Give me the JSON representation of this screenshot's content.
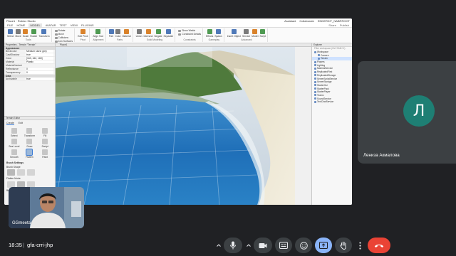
{
  "screen_share": {
    "title_left": "Place1 · Roblox Studio",
    "title_right": [
      "Assistant",
      "Collaborate"
    ],
    "user": "ENDERKIT_NABRROOT",
    "menu": [
      "FILE",
      "HOME",
      "MODEL",
      "AVATAR",
      "TEST",
      "VIEW",
      "PLUGINS"
    ],
    "menu_active": "MODEL",
    "menu_right": [
      "Share",
      "Publish"
    ],
    "ribbon_groups": [
      {
        "label": "Tools",
        "tools": [
          "Select",
          "Move",
          "Scale",
          "Rotate",
          "Transform"
        ]
      },
      {
        "label": "Snapping",
        "mini": [
          "Rotate",
          "Move",
          "Collisions",
          "Join Surfaces"
        ]
      },
      {
        "label": "Pivot",
        "tools": [
          "Edit Pivot"
        ]
      },
      {
        "label": "Alignment",
        "tools": [
          "Align Tool"
        ]
      },
      {
        "label": "Parts",
        "tools": [
          "Part",
          "Color",
          "Material"
        ]
      },
      {
        "label": "Solid Modeling",
        "tools": [
          "Union",
          "Intersect",
          "Negate",
          "Separate"
        ]
      },
      {
        "label": "Constraints",
        "mini": [
          "Show Welds",
          "Constraint Details"
        ]
      },
      {
        "label": "Gameplay",
        "tools": [
          "Effects",
          "Spawn"
        ]
      },
      {
        "label": "Advanced",
        "tools": [
          "Insert Object",
          "Service",
          "Model",
          "Script"
        ]
      }
    ],
    "properties_header": "Properties - Terrain \"Terrain\"",
    "properties": [
      {
        "section": "Appearance"
      },
      {
        "k": "BrickColor",
        "v": "Medium stone grey"
      },
      {
        "k": "CastShadow",
        "v": "true"
      },
      {
        "k": "Color",
        "v": "[163, 162, 165]"
      },
      {
        "k": "Material",
        "v": "Plastic"
      },
      {
        "k": "MaterialVariant",
        "v": ""
      },
      {
        "k": "Reflectance",
        "v": "0"
      },
      {
        "k": "Transparency",
        "v": "0"
      },
      {
        "section": "Data"
      },
      {
        "k": "Archivable",
        "v": "true"
      }
    ],
    "terrain_title": "Terrain Editor",
    "terrain_tabs": [
      "Create",
      "Edit"
    ],
    "terrain_tools": [
      "Select",
      "Transform",
      "Fill",
      "Sea Level",
      "Draw",
      "Sculpt",
      "Smooth",
      "Flatten",
      "Paint"
    ],
    "terrain_selected": "Flatten",
    "brush_settings": "Brush Settings",
    "brush_shape": "Brush Shape",
    "flatten_mode": "Flatten Mode",
    "brush_size": "Brush Size",
    "viewport_tab": "Place1",
    "explorer_title": "Explorer",
    "explorer_filter": "Filter workspace (Ctrl+Shift+X)",
    "explorer": [
      {
        "name": "Workspace",
        "level": 0
      },
      {
        "name": "Camera",
        "level": 1
      },
      {
        "name": "Terrain",
        "level": 1,
        "selected": true
      },
      {
        "name": "Players",
        "level": 0
      },
      {
        "name": "Lighting",
        "level": 0
      },
      {
        "name": "MaterialService",
        "level": 0
      },
      {
        "name": "ReplicatedFirst",
        "level": 0
      },
      {
        "name": "ReplicatedStorage",
        "level": 0
      },
      {
        "name": "ServerScriptService",
        "level": 0
      },
      {
        "name": "ServerStorage",
        "level": 0
      },
      {
        "name": "StarterGui",
        "level": 0
      },
      {
        "name": "StarterPack",
        "level": 0
      },
      {
        "name": "StarterPlayer",
        "level": 0
      },
      {
        "name": "Teams",
        "level": 0
      },
      {
        "name": "SoundService",
        "level": 0
      },
      {
        "name": "TextChatService",
        "level": 0
      }
    ]
  },
  "participant": {
    "initial": "Л",
    "name": "Лениза Акмалова",
    "avatar_color": "#1e7f74"
  },
  "self_view": {
    "name": "GGmeeta"
  },
  "meeting": {
    "time": "18:35",
    "separator": "|",
    "code": "gfa-crri-jhp"
  },
  "controls": [
    "mic",
    "camera",
    "captions",
    "emoji",
    "present",
    "raise-hand",
    "more",
    "leave"
  ],
  "colors": {
    "leave": "#ea4335",
    "present_active": "#8ab4f8",
    "background": "#202124"
  }
}
